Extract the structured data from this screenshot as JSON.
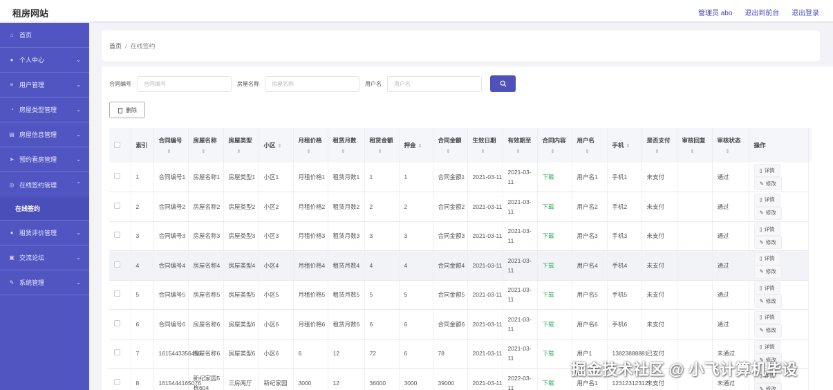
{
  "app": {
    "title": "租房网站"
  },
  "header": {
    "admin_label": "管理员 abo",
    "to_front": "退出到前台",
    "logout": "退出登录"
  },
  "sidebar": {
    "items": [
      {
        "label": "首页",
        "icon": "home-icon",
        "glyph": "⌂",
        "chevron": false
      },
      {
        "label": "个人中心",
        "icon": "user-icon",
        "glyph": "●",
        "chevron": true
      },
      {
        "label": "用户管理",
        "icon": "list-icon",
        "glyph": "≡",
        "chevron": true
      },
      {
        "label": "房屋类型管理",
        "icon": "clock-icon",
        "glyph": "◔",
        "chevron": true
      },
      {
        "label": "房屋信息管理",
        "icon": "building-icon",
        "glyph": "▤",
        "chevron": true
      },
      {
        "label": "预约看房管理",
        "icon": "send-icon",
        "glyph": "➤",
        "chevron": true
      },
      {
        "label": "在线签约管理",
        "icon": "settings-icon",
        "glyph": "◎",
        "chevron": true
      },
      {
        "label": "租赁评价管理",
        "icon": "person-icon",
        "glyph": "●",
        "chevron": true
      },
      {
        "label": "交流论坛",
        "icon": "image-icon",
        "glyph": "▣",
        "chevron": true
      },
      {
        "label": "系统管理",
        "icon": "tool-icon",
        "glyph": "✎",
        "chevron": true
      }
    ],
    "sub_item": "在线签约"
  },
  "breadcrumb": {
    "home": "首页",
    "sep": "/",
    "current": "在线签约"
  },
  "search": {
    "contract_label": "合同编号",
    "contract_placeholder": "合同编号",
    "house_label": "房屋名称",
    "house_placeholder": "房屋名称",
    "user_label": "用户名",
    "user_placeholder": "用户名"
  },
  "toolbar": {
    "delete_label": "删除"
  },
  "table": {
    "headers": [
      "索引",
      "合同编号",
      "房屋名称",
      "房屋类型",
      "小区",
      "月租价格",
      "租赁月数",
      "租赁金额",
      "押金",
      "合同金额",
      "生效日期",
      "有效期至",
      "合同内容",
      "用户名",
      "手机",
      "是否支付",
      "审核回复",
      "审核状态",
      "操作"
    ],
    "sort_glyph": "⇕",
    "download_label": "下载",
    "detail_label": "详情",
    "edit_label": "修改",
    "rows": [
      [
        "1",
        "合同编号1",
        "房屋名称1",
        "房屋类型1",
        "小区1",
        "月租价格1",
        "租赁月数1",
        "1",
        "1",
        "合同金额1",
        "2021-03-11",
        "2021-03-11",
        "下载",
        "用户名1",
        "手机1",
        "未支付",
        "",
        "通过"
      ],
      [
        "2",
        "合同编号2",
        "房屋名称2",
        "房屋类型2",
        "小区2",
        "月租价格2",
        "租赁月数2",
        "2",
        "2",
        "合同金额2",
        "2021-03-11",
        "2021-03-11",
        "下载",
        "用户名2",
        "手机2",
        "未支付",
        "",
        "通过"
      ],
      [
        "3",
        "合同编号3",
        "房屋名称3",
        "房屋类型3",
        "小区3",
        "月租价格3",
        "租赁月数3",
        "3",
        "3",
        "合同金额3",
        "2021-03-11",
        "2021-03-11",
        "下载",
        "用户名3",
        "手机3",
        "未支付",
        "",
        "通过"
      ],
      [
        "4",
        "合同编号4",
        "房屋名称4",
        "房屋类型4",
        "小区4",
        "月租价格4",
        "租赁月数4",
        "4",
        "4",
        "合同金额4",
        "2021-03-11",
        "2021-03-11",
        "下载",
        "用户名4",
        "手机4",
        "未支付",
        "",
        "通过"
      ],
      [
        "5",
        "合同编号5",
        "房屋名称5",
        "房屋类型5",
        "小区5",
        "月租价格5",
        "租赁月数5",
        "5",
        "5",
        "合同金额5",
        "2021-03-11",
        "2021-03-11",
        "下载",
        "用户名5",
        "手机5",
        "未支付",
        "",
        "通过"
      ],
      [
        "6",
        "合同编号6",
        "房屋名称6",
        "房屋类型6",
        "小区6",
        "月租价格6",
        "租赁月数6",
        "6",
        "6",
        "合同金额6",
        "2021-03-11",
        "2021-03-11",
        "下载",
        "用户名6",
        "手机6",
        "未支付",
        "",
        "通过"
      ],
      [
        "7",
        "1615443356456",
        "房屋名称6",
        "房屋类型6",
        "小区6",
        "6",
        "12",
        "72",
        "6",
        "78",
        "2021-03-11",
        "2021-03-11",
        "下载",
        "用户1",
        "13823888881",
        "已支付",
        "",
        "未通过"
      ],
      [
        "8",
        "1615444165076",
        "新纪家园5栋604",
        "三房两厅",
        "新纪家园",
        "3000",
        "12",
        "36000",
        "3000",
        "39000",
        "2021-03-11",
        "2022-03-11",
        "下载",
        "用户名1",
        "12312312312",
        "未支付",
        "",
        "未通过"
      ]
    ]
  },
  "watermark": "掘金技术社区 @ 小飞计算机毕设"
}
